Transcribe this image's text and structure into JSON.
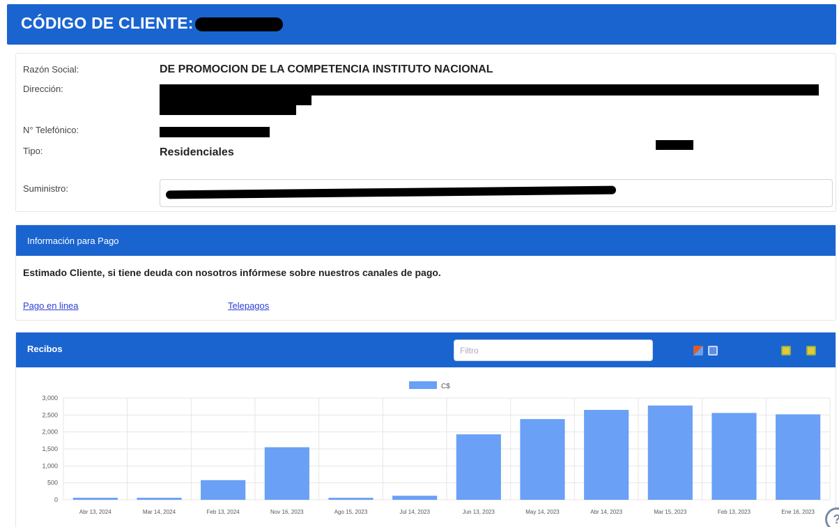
{
  "header": {
    "title": "CÓDIGO DE CLIENTE:"
  },
  "client": {
    "razon_label": "Razón Social:",
    "razon_value": "DE PROMOCION DE LA COMPETENCIA INSTITUTO NACIONAL",
    "direccion_label": "Dirección:",
    "telefono_label": "N° Telefónico:",
    "tipo_label": "Tipo:",
    "tipo_value": "Residenciales",
    "suministro_label": "Suministro:"
  },
  "payment": {
    "title": "Información para Pago",
    "message": "Estimado Cliente, si tiene deuda con nosotros infórmese sobre nuestros canales de pago.",
    "links": [
      "Pago en linea",
      "Telepagos"
    ]
  },
  "receipts": {
    "title": "Recibos",
    "filter_placeholder": "Filtro"
  },
  "icons": {
    "chart": "chart-export-icon",
    "document": "document-export-icon",
    "a": "coin-icon",
    "b": "coin-icon"
  },
  "colors": {
    "primary": "#1a64d0",
    "bar": "#6aa0f5"
  },
  "chart_data": {
    "type": "bar",
    "legend": "C$",
    "categories": [
      "Abr 13, 2024",
      "Mar 14, 2024",
      "Feb 13, 2024",
      "Nov 16, 2023",
      "Ago 15, 2023",
      "Jul 14, 2023",
      "Jun 13, 2023",
      "May 14, 2023",
      "Abr 14, 2023",
      "Mar 15, 2023",
      "Feb 13, 2023",
      "Ene 16, 2023"
    ],
    "values": [
      60,
      60,
      580,
      1550,
      60,
      120,
      1930,
      2380,
      2650,
      2780,
      2560,
      2520
    ],
    "yticks": [
      "0",
      "500",
      "1,000",
      "1,500",
      "2,000",
      "2,500",
      "3,000"
    ],
    "ylim": [
      0,
      3000
    ],
    "grid": true,
    "legend_position": "top-center"
  }
}
